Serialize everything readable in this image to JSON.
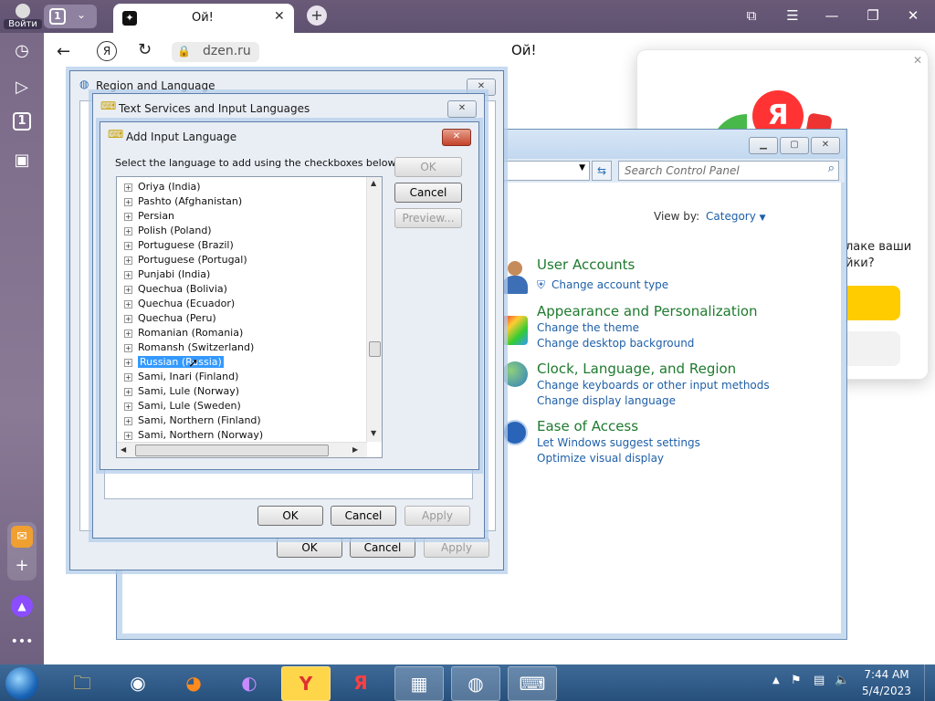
{
  "browser": {
    "login_label": "Войти",
    "tab_count": "1",
    "tab_title": "Ой!",
    "page_title": "Ой!",
    "url": "dzen.ru",
    "ya_label": "Я",
    "new_tab_icon": "plus-icon",
    "left_icons": [
      "clock-icon",
      "play-icon",
      "counter-icon",
      "camera-icon",
      "mail-icon",
      "add-icon",
      "alice-icon",
      "more-icon"
    ],
    "left_counter": "1"
  },
  "popup": {
    "line1": "лаке ваши",
    "line2": "йки?",
    "ya_badge": "Я",
    "accent": "#ffcc00"
  },
  "control_panel": {
    "search_placeholder": "Search Control Panel",
    "view_by_label": "View by:",
    "view_by_value": "Category",
    "categories": [
      {
        "title": "User Accounts",
        "links": [
          "Change account type"
        ]
      },
      {
        "title": "Appearance and Personalization",
        "links": [
          "Change the theme",
          "Change desktop background"
        ]
      },
      {
        "title": "Clock, Language, and Region",
        "links": [
          "Change keyboards or other input methods",
          "Change display language"
        ]
      },
      {
        "title": "Ease of Access",
        "links": [
          "Let Windows suggest settings",
          "Optimize visual display"
        ]
      }
    ]
  },
  "region_dialog": {
    "title": "Region and Language",
    "ok": "OK",
    "cancel": "Cancel",
    "apply": "Apply"
  },
  "tsil_dialog": {
    "title": "Text Services and Input Languages",
    "ok": "OK",
    "cancel": "Cancel",
    "apply": "Apply"
  },
  "add_dialog": {
    "title": "Add Input Language",
    "instruction": "Select the language to add using the checkboxes below.",
    "ok": "OK",
    "cancel": "Cancel",
    "preview": "Preview...",
    "selected_index": 12,
    "languages": [
      "Oriya (India)",
      "Pashto (Afghanistan)",
      "Persian",
      "Polish (Poland)",
      "Portuguese (Brazil)",
      "Portuguese (Portugal)",
      "Punjabi (India)",
      "Quechua (Bolivia)",
      "Quechua (Ecuador)",
      "Quechua (Peru)",
      "Romanian (Romania)",
      "Romansh (Switzerland)",
      "Russian (Russia)",
      "Sami, Inari (Finland)",
      "Sami, Lule (Norway)",
      "Sami, Lule (Sweden)",
      "Sami, Northern (Finland)",
      "Sami, Northern (Norway)"
    ]
  },
  "taskbar": {
    "apps": [
      "explorer-icon",
      "chrome-icon",
      "firefox-icon",
      "browser-icon",
      "yandex-icon",
      "yandex-browser-icon",
      "control-panel-icon",
      "globe-icon",
      "keyboard-icon"
    ],
    "time": "7:44 AM",
    "date": "5/4/2023"
  }
}
